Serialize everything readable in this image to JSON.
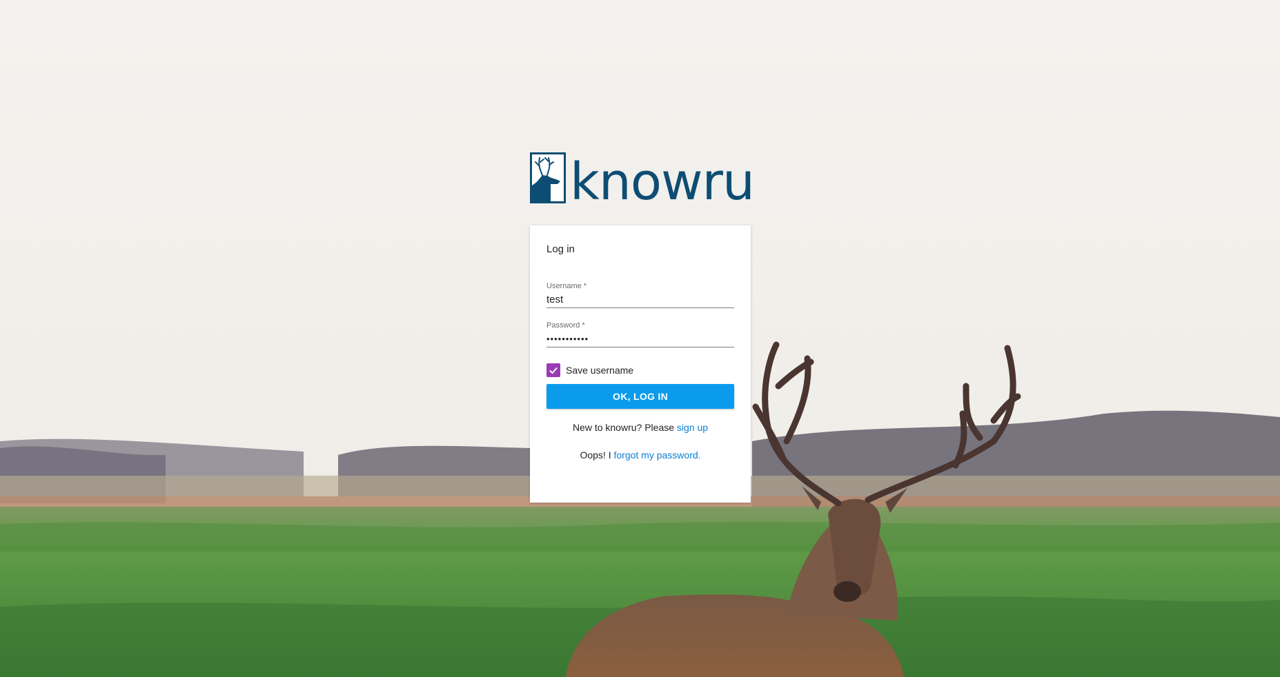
{
  "brand": {
    "name": "knowru",
    "logo_icon": "deer-head-icon",
    "color": "#0e4d73"
  },
  "login": {
    "title": "Log in",
    "username": {
      "label": "Username *",
      "value": "test"
    },
    "password": {
      "label": "Password *",
      "value": "•••••••••••"
    },
    "save_username": {
      "label": "Save username",
      "checked": true
    },
    "submit_label": "OK, LOG IN",
    "signup_prefix": "New to knowru? Please",
    "signup_link": "sign up",
    "forgot_prefix": "Oops! I",
    "forgot_link": "forgot my password."
  },
  "colors": {
    "accent": "#0a9bec",
    "checkbox": "#9c3cb4",
    "link": "#0a7fd4",
    "background": "#f3f1ed"
  }
}
